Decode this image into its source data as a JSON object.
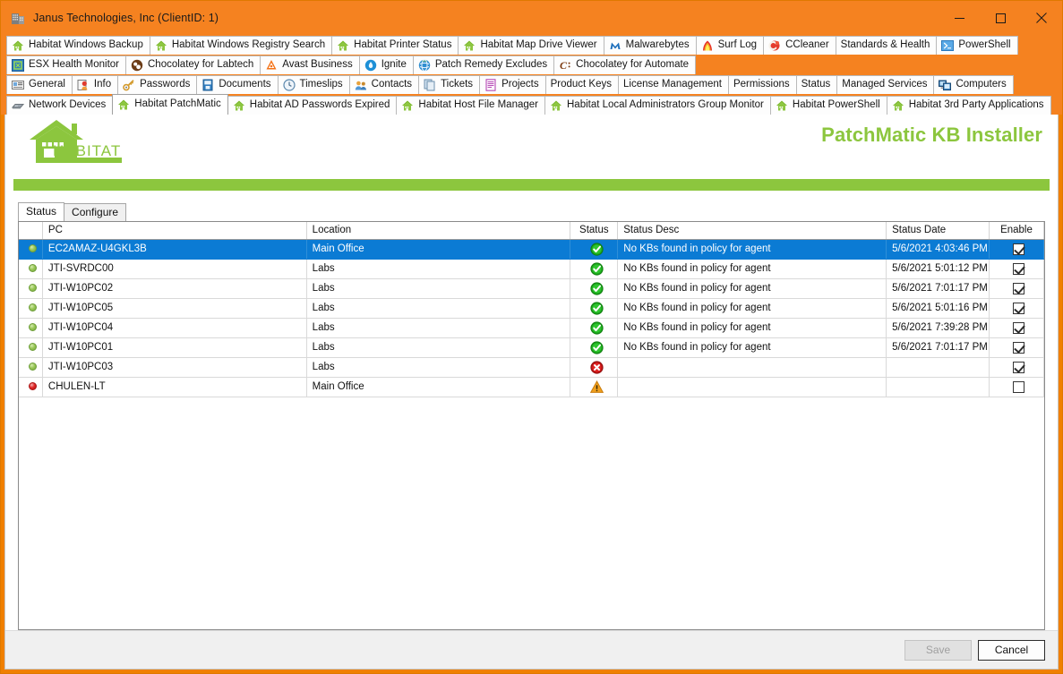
{
  "window": {
    "title": "Janus Technologies, Inc   (ClientID: 1)",
    "icon": "building-icon",
    "minimize_label": "Minimize",
    "maximize_label": "Maximize",
    "close_label": "Close",
    "accent_color": "#f58220"
  },
  "tab_rows": [
    [
      {
        "label": "Habitat Windows Backup",
        "icon": "habitat-house-icon"
      },
      {
        "label": "Habitat Windows Registry Search",
        "icon": "habitat-house-icon"
      },
      {
        "label": "Habitat Printer Status",
        "icon": "habitat-house-icon"
      },
      {
        "label": "Habitat Map Drive Viewer",
        "icon": "habitat-house-icon"
      },
      {
        "label": "Malwarebytes",
        "icon": "malwarebytes-icon"
      },
      {
        "label": "Surf Log",
        "icon": "surflog-icon"
      },
      {
        "label": "CCleaner",
        "icon": "ccleaner-icon"
      },
      {
        "label": "Standards & Health",
        "icon": "none"
      },
      {
        "label": "PowerShell",
        "icon": "powershell-icon"
      }
    ],
    [
      {
        "label": "ESX Health Monitor",
        "icon": "esx-icon"
      },
      {
        "label": "Chocolatey for Labtech",
        "icon": "chocolatey-icon"
      },
      {
        "label": "Avast Business",
        "icon": "avast-icon"
      },
      {
        "label": "Ignite",
        "icon": "ignite-icon"
      },
      {
        "label": "Patch Remedy Excludes",
        "icon": "globe-icon"
      },
      {
        "label": "Chocolatey for Automate",
        "icon": "chocolatey-c-icon"
      }
    ],
    [
      {
        "label": "General",
        "icon": "general-card-icon"
      },
      {
        "label": "Info",
        "icon": "info-person-icon"
      },
      {
        "label": "Passwords",
        "icon": "key-icon"
      },
      {
        "label": "Documents",
        "icon": "documents-icon"
      },
      {
        "label": "Timeslips",
        "icon": "clock-icon"
      },
      {
        "label": "Contacts",
        "icon": "contacts-icon"
      },
      {
        "label": "Tickets",
        "icon": "tickets-icon"
      },
      {
        "label": "Projects",
        "icon": "projects-icon"
      },
      {
        "label": "Product Keys",
        "icon": "none"
      },
      {
        "label": "License Management",
        "icon": "none"
      },
      {
        "label": "Permissions",
        "icon": "none"
      },
      {
        "label": "Status",
        "icon": "none"
      },
      {
        "label": "Managed Services",
        "icon": "none"
      },
      {
        "label": "Computers",
        "icon": "computers-icon"
      }
    ],
    [
      {
        "label": "Network Devices",
        "icon": "network-device-icon"
      },
      {
        "label": "Habitat PatchMatic",
        "icon": "habitat-house-icon",
        "active": true
      },
      {
        "label": "Habitat AD Passwords Expired",
        "icon": "habitat-house-icon"
      },
      {
        "label": "Habitat Host File Manager",
        "icon": "habitat-house-icon"
      },
      {
        "label": "Habitat Local Administrators Group Monitor",
        "icon": "habitat-house-icon"
      },
      {
        "label": "Habitat PowerShell",
        "icon": "habitat-house-icon"
      },
      {
        "label": "Habitat 3rd Party Applications",
        "icon": "habitat-house-icon"
      }
    ]
  ],
  "branding": {
    "logo_text": "HABITAT",
    "app_title": "PatchMatic KB Installer",
    "brand_green": "#8cc63e"
  },
  "inner_tabs": [
    {
      "label": "Status",
      "active": true
    },
    {
      "label": "Configure",
      "active": false
    }
  ],
  "grid": {
    "columns": [
      "",
      "PC",
      "Location",
      "Status",
      "Status Desc",
      "Status Date",
      "Enable"
    ],
    "rows": [
      {
        "marker": "green",
        "pc": "EC2AMAZ-U4GKL3B",
        "location": "Main Office",
        "status": "success",
        "status_desc": "No KBs found in policy for agent",
        "status_date": "5/6/2021 4:03:46 PM",
        "enable": true,
        "selected": true
      },
      {
        "marker": "green",
        "pc": "JTI-SVRDC00",
        "location": "Labs",
        "status": "success",
        "status_desc": "No KBs found in policy for agent",
        "status_date": "5/6/2021 5:01:12 PM",
        "enable": true,
        "selected": false
      },
      {
        "marker": "green",
        "pc": "JTI-W10PC02",
        "location": "Labs",
        "status": "success",
        "status_desc": "No KBs found in policy for agent",
        "status_date": "5/6/2021 7:01:17 PM",
        "enable": true,
        "selected": false
      },
      {
        "marker": "green",
        "pc": "JTI-W10PC05",
        "location": "Labs",
        "status": "success",
        "status_desc": "No KBs found in policy for agent",
        "status_date": "5/6/2021 5:01:16 PM",
        "enable": true,
        "selected": false
      },
      {
        "marker": "green",
        "pc": "JTI-W10PC04",
        "location": "Labs",
        "status": "success",
        "status_desc": "No KBs found in policy for agent",
        "status_date": "5/6/2021 7:39:28 PM",
        "enable": true,
        "selected": false
      },
      {
        "marker": "green",
        "pc": "JTI-W10PC01",
        "location": "Labs",
        "status": "success",
        "status_desc": "No KBs found in policy for agent",
        "status_date": "5/6/2021 7:01:17 PM",
        "enable": true,
        "selected": false
      },
      {
        "marker": "green",
        "pc": "JTI-W10PC03",
        "location": "Labs",
        "status": "error",
        "status_desc": "",
        "status_date": "",
        "enable": true,
        "selected": false
      },
      {
        "marker": "red",
        "pc": "CHULEN-LT",
        "location": "Main Office",
        "status": "warning",
        "status_desc": "",
        "status_date": "",
        "enable": false,
        "selected": false
      }
    ]
  },
  "footer": {
    "save_label": "Save",
    "save_disabled": true,
    "cancel_label": "Cancel"
  }
}
